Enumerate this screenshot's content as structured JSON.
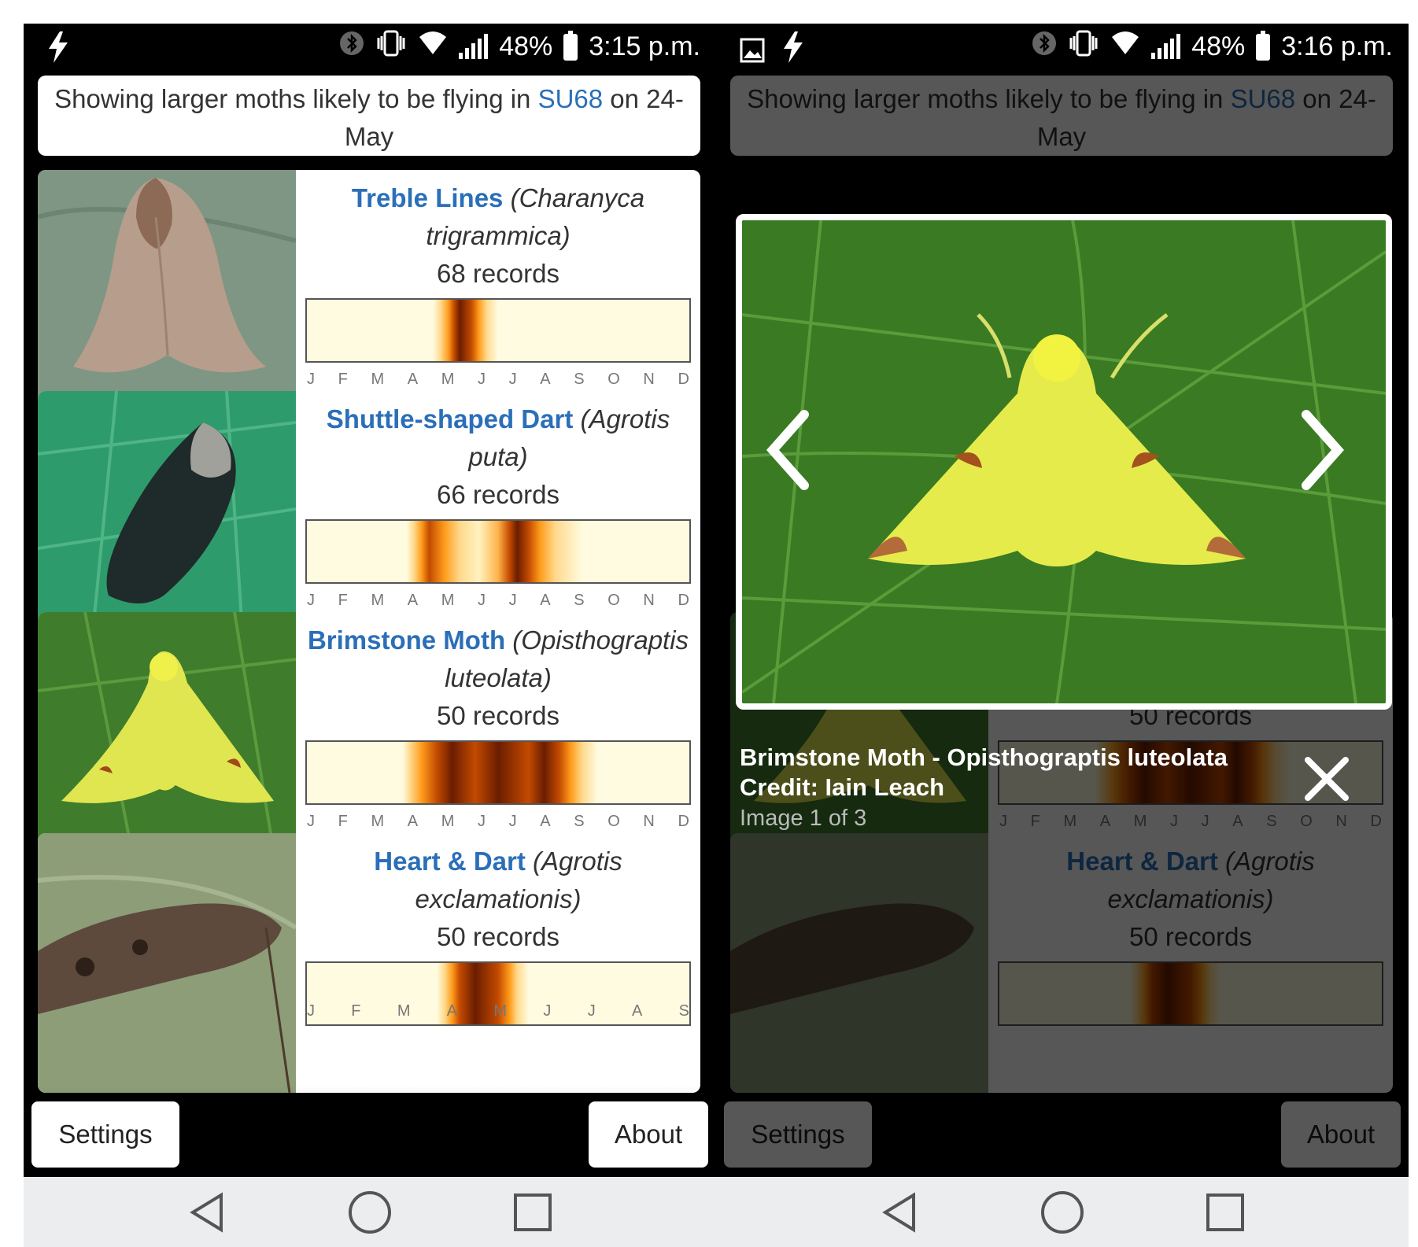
{
  "status_left": {
    "battery": "48%",
    "time": "3:15 p.m."
  },
  "status_right": {
    "battery": "48%",
    "time": "3:16 p.m."
  },
  "header": {
    "prefix": "Showing larger moths likely to be flying in ",
    "location": "SU68",
    "suffix": " on 24-May"
  },
  "months": [
    "J",
    "F",
    "M",
    "A",
    "M",
    "J",
    "J",
    "A",
    "S",
    "O",
    "N",
    "D"
  ],
  "moths": [
    {
      "name": "Treble Lines",
      "sci": "(Charanyca trigrammica)",
      "records": "68 records"
    },
    {
      "name": "Shuttle-shaped Dart",
      "sci": "(Agrotis puta)",
      "records": "66 records"
    },
    {
      "name": "Brimstone Moth",
      "sci": "(Opisthograptis luteolata)",
      "records": "50 records"
    },
    {
      "name": "Heart & Dart",
      "sci": "(Agrotis exclamationis)",
      "records": "50 records"
    }
  ],
  "buttons": {
    "settings": "Settings",
    "about": "About"
  },
  "lightbox": {
    "title": "Brimstone Moth - Opisthograptis luteolata",
    "credit": "Credit: Iain Leach",
    "count": "Image 1 of 3"
  },
  "icons": [
    "flash-icon",
    "image-icon",
    "bluetooth-icon",
    "vibrate-icon",
    "wifi-icon",
    "signal-icon",
    "battery-icon",
    "back-icon",
    "home-icon",
    "recents-icon",
    "chevron-left-icon",
    "chevron-right-icon",
    "close-icon"
  ],
  "colors": {
    "link": "#2a6fb8",
    "peak": "#6b1d00",
    "low": "#fffbe0"
  }
}
